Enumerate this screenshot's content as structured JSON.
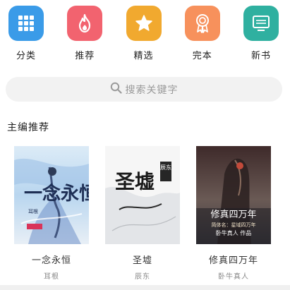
{
  "categories": [
    {
      "label": "分类",
      "icon": "grid-icon",
      "color": "#3a9be8"
    },
    {
      "label": "推荐",
      "icon": "flame-icon",
      "color": "#f2636f"
    },
    {
      "label": "精选",
      "icon": "star-icon",
      "color": "#f1a92f"
    },
    {
      "label": "完本",
      "icon": "award-ribbon-icon",
      "color": "#f7915c"
    },
    {
      "label": "新书",
      "icon": "monitor-icon",
      "color": "#2fb0a0"
    }
  ],
  "search": {
    "placeholder": "搜索关键字"
  },
  "section": {
    "title": "主编推荐"
  },
  "books": [
    {
      "title": "一念永恒",
      "author": "耳根",
      "cover_title": "一念永恒",
      "cover_author": "耳根"
    },
    {
      "title": "圣墟",
      "author": "辰东",
      "cover_title": "圣墟",
      "cover_author": "辰东"
    },
    {
      "title": "修真四万年",
      "author": "卧牛真人",
      "cover_title": "修真四万年",
      "cover_subtitle": "简体名：星域四万年",
      "cover_author": "卧牛真人 作品"
    }
  ]
}
